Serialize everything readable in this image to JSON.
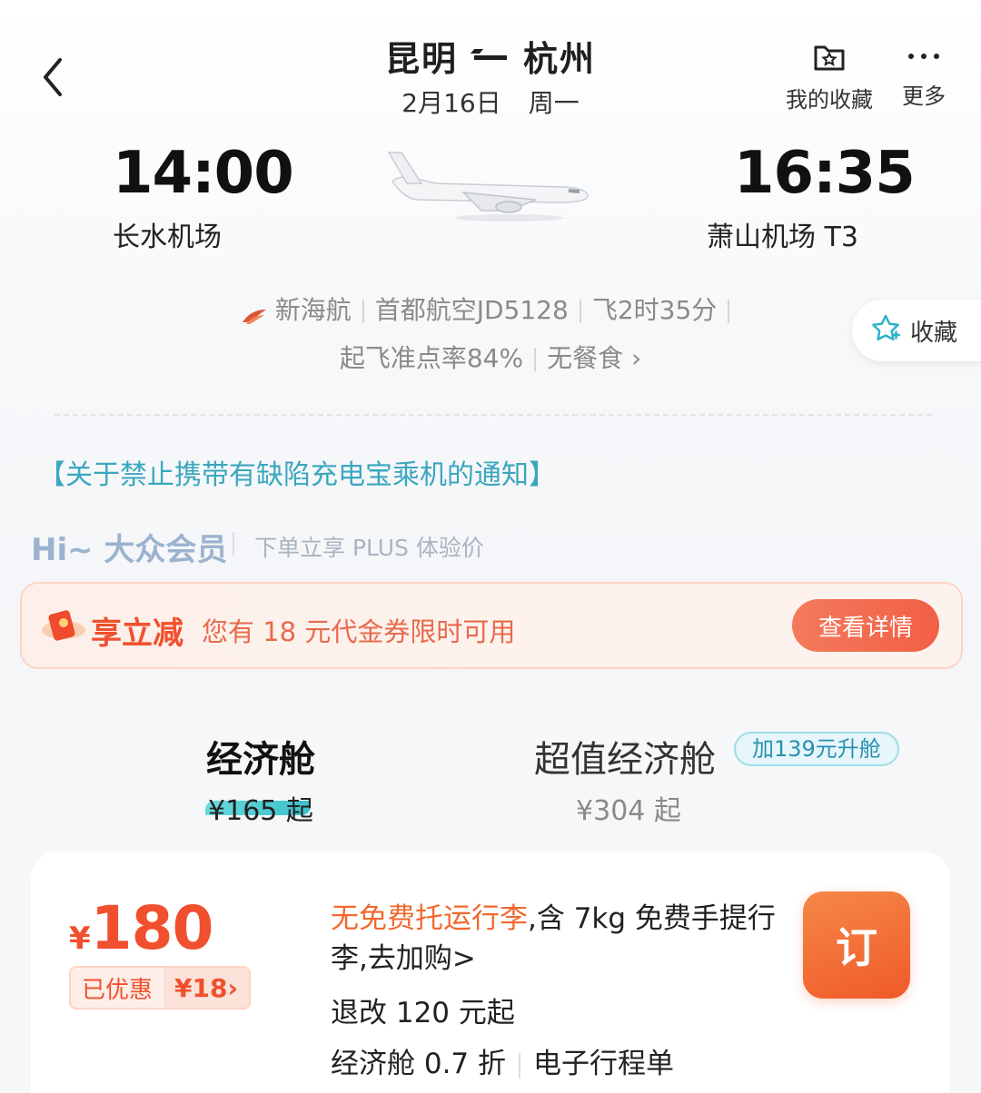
{
  "header": {
    "origin": "昆明",
    "destination": "杭州",
    "date": "2月16日",
    "weekday": "周一",
    "favorites_label": "我的收藏",
    "more_label": "更多"
  },
  "flight": {
    "departure_time": "14:00",
    "departure_airport": "长水机场",
    "arrival_time": "16:35",
    "arrival_airport": "萧山机场 T3",
    "airline": "新海航",
    "operator_flight": "首都航空JD5128",
    "duration": "飞2时35分",
    "on_time_rate": "起飞准点率84%",
    "meal": "无餐食",
    "side_favorite_label": "收藏"
  },
  "notice": "【关于禁止携带有缺陷充电宝乘机的通知】",
  "member": {
    "greeting": "Hi~ 大众会员",
    "benefit": "下单立享 PLUS 体验价"
  },
  "coupon": {
    "title": "享立减",
    "text": "您有 18 元代金券限时可用",
    "button": "查看详情"
  },
  "cabins": {
    "economy": {
      "name": "经济舱",
      "price": "¥165 起"
    },
    "super_economy": {
      "name": "超值经济舱",
      "price": "¥304 起",
      "upgrade": "加139元升舱"
    }
  },
  "fare": {
    "currency": "¥",
    "price": "180",
    "discount_label": "已优惠",
    "discount_amount": "¥18",
    "baggage_highlight": "无免费托运行李",
    "baggage_rest": ",含 7kg 免费手提行李,去加购>",
    "refund": "退改 120 元起",
    "cabin_discount": "经济舱 0.7 折",
    "itinerary": "电子行程单",
    "book_label": "订"
  },
  "colors": {
    "accent_orange": "#f0502e",
    "teal": "#3aa7be"
  }
}
